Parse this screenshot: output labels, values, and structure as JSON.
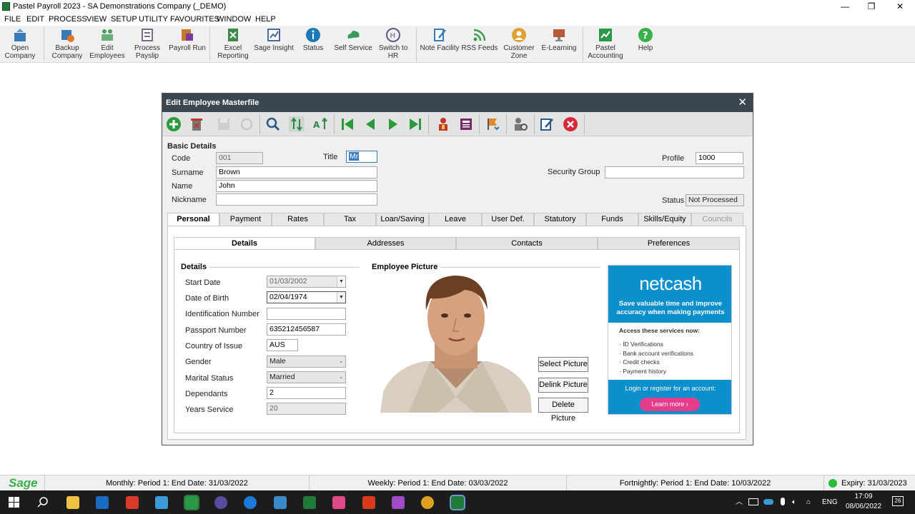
{
  "window": {
    "title": "Pastel Payroll 2023 - SA Demonstrations Company (_DEMO)",
    "controls": [
      "—",
      "❐",
      "✕"
    ]
  },
  "menu": [
    "FILE",
    "EDIT",
    "PROCESS",
    "VIEW",
    "SETUP",
    "UTILITY",
    "FAVOURITES",
    "WINDOW",
    "HELP"
  ],
  "toolbar": [
    {
      "l1": "Open",
      "l2": "Company",
      "icon": "open-company-icon",
      "color": "#3a7ab8"
    },
    {
      "l1": "Backup",
      "l2": "Company",
      "icon": "backup-company-icon",
      "color": "#3a7ab8"
    },
    {
      "l1": "Edit",
      "l2": "Employees",
      "icon": "edit-employees-icon",
      "color": "#4e9a5a"
    },
    {
      "l1": "Process",
      "l2": "Payslip",
      "icon": "process-payslip-icon",
      "color": "#7a6a8a"
    },
    {
      "l1": "Payroll Run",
      "l2": "",
      "icon": "payroll-run-icon",
      "color": "#c47a2a"
    },
    {
      "l1": "Excel",
      "l2": "Reporting",
      "icon": "excel-reporting-icon",
      "color": "#3b8a4a"
    },
    {
      "l1": "Sage Insight",
      "l2": "",
      "icon": "sage-insight-icon",
      "color": "#4b6b9b"
    },
    {
      "l1": "Status",
      "l2": "",
      "icon": "status-icon",
      "color": "#1a7ab8"
    },
    {
      "l1": "Self Service",
      "l2": "",
      "icon": "self-service-icon",
      "color": "#3a9a5a"
    },
    {
      "l1": "Switch to",
      "l2": "HR",
      "icon": "switch-to-hr-icon",
      "color": "#5a5a8a"
    },
    {
      "l1": "Note Facility",
      "l2": "",
      "icon": "note-facility-icon",
      "color": "#3a7ab8"
    },
    {
      "l1": "RSS Feeds",
      "l2": "",
      "icon": "rss-feeds-icon",
      "color": "#3aa04a"
    },
    {
      "l1": "Customer",
      "l2": "Zone",
      "icon": "customer-zone-icon",
      "color": "#e0a030"
    },
    {
      "l1": "E-Learning",
      "l2": "",
      "icon": "e-learning-icon",
      "color": "#b85a3a"
    },
    {
      "l1": "Pastel",
      "l2": "Accounting",
      "icon": "pastel-accounting-icon",
      "color": "#2a9a4a"
    },
    {
      "l1": "Help",
      "l2": "",
      "icon": "help-icon",
      "color": "#3ab04a"
    }
  ],
  "dialog": {
    "title": "Edit Employee Masterfile",
    "close": "✕",
    "section_basic": "Basic Details",
    "labels": {
      "code": "Code",
      "surname": "Surname",
      "name": "Name",
      "nickname": "Nickname",
      "title": "Title",
      "profile": "Profile",
      "security_group": "Security Group",
      "status": "Status"
    },
    "values": {
      "code": "001",
      "surname": "Brown",
      "name": "John",
      "nickname": "",
      "title": "Mr",
      "profile": "1000",
      "security_group": "",
      "status": "Not Processed"
    },
    "tabs": [
      "Personal",
      "Payment",
      "Rates",
      "Tax",
      "Loan/Saving",
      "Leave",
      "User Def.",
      "Statutory",
      "Funds",
      "Skills/Equity",
      "Councils"
    ],
    "subtabs": [
      "Details",
      "Addresses",
      "Contacts",
      "Preferences"
    ],
    "details_section": "Details",
    "picture_section": "Employee Picture",
    "details": [
      {
        "label": "Start Date",
        "value": "01/03/2002"
      },
      {
        "label": "Date of Birth",
        "value": "02/04/1974"
      },
      {
        "label": "Identification Number",
        "value": ""
      },
      {
        "label": "Passport Number",
        "value": "635212456587"
      },
      {
        "label": "Country of Issue",
        "value": "AUS"
      },
      {
        "label": "Gender",
        "value": "Male"
      },
      {
        "label": "Marital Status",
        "value": "Married"
      },
      {
        "label": "Dependants",
        "value": "2"
      },
      {
        "label": "Years Service",
        "value": "20"
      }
    ],
    "buttons": {
      "select": "Select Picture",
      "delink": "Delink Picture",
      "delete": "Delete Picture"
    }
  },
  "ad": {
    "logo": "netcash",
    "tagline": "Save valuable time and improve accuracy when making payments",
    "subhead": "Access these services now:",
    "items": [
      "· ID Verifications",
      "· Bank account verifications",
      "· Credit checks",
      "· Payment history"
    ],
    "login": "Login or register for an account:",
    "cta": "Learn more  ›"
  },
  "statusbar": {
    "brand": "Sage",
    "monthly": "Monthly: Period 1: End Date: 31/03/2022",
    "weekly": "Weekly: Period 1: End Date: 03/03/2022",
    "fortnightly": "Fortnightly: Period 1: End Date: 10/03/2022",
    "expiry": "Expiry: 31/03/2023"
  },
  "taskbar": {
    "lang": "ENG",
    "time": "17:09",
    "date": "08/06/2022",
    "notifications": "26"
  }
}
